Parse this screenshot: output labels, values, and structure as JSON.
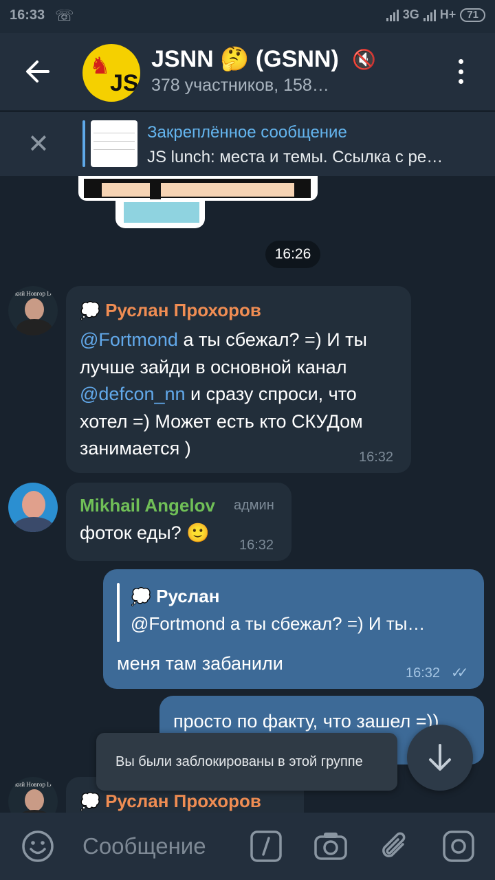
{
  "status_bar": {
    "time": "16:33",
    "network_1": "3G",
    "network_2": "H+",
    "battery": "71"
  },
  "header": {
    "title": "JSNN 🤔 (GSNN)",
    "subtitle": "378 участников, 158…",
    "avatar_text": "JS"
  },
  "pinned": {
    "title": "Закреплённое сообщение",
    "text": "JS lunch: места и темы. Ссылка с ре…"
  },
  "date_pill": "16:26",
  "messages": [
    {
      "sender": "Руслан Прохоров",
      "parts": [
        "@Fortmond",
        " а ты сбежал? =) И ты лучше зайди в основной канал ",
        "@defcon_nn",
        " и сразу спроси, что хотел =) Может есть кто СКУДом занимается )"
      ],
      "time": "16:32"
    },
    {
      "sender": "Mikhail Angelov",
      "badge": "админ",
      "text": "фоток еды? 🙂",
      "time": "16:32"
    },
    {
      "reply_to": "Руслан",
      "reply_text": "@Fortmond а ты сбежал? =) И ты…",
      "text": "меня там забанили",
      "time": "16:32"
    },
    {
      "text": "просто по факту, что зашел =))"
    },
    {
      "sender": "Руслан Прохоров"
    }
  ],
  "toast": "Вы были заблокированы в этой группе",
  "input": {
    "placeholder": "Сообщение"
  },
  "colors": {
    "accent": "#62a9eb",
    "sender_orange": "#f08d53",
    "sender_green": "#70bf57",
    "outgoing": "#3d6a97",
    "incoming": "#222e3a"
  }
}
